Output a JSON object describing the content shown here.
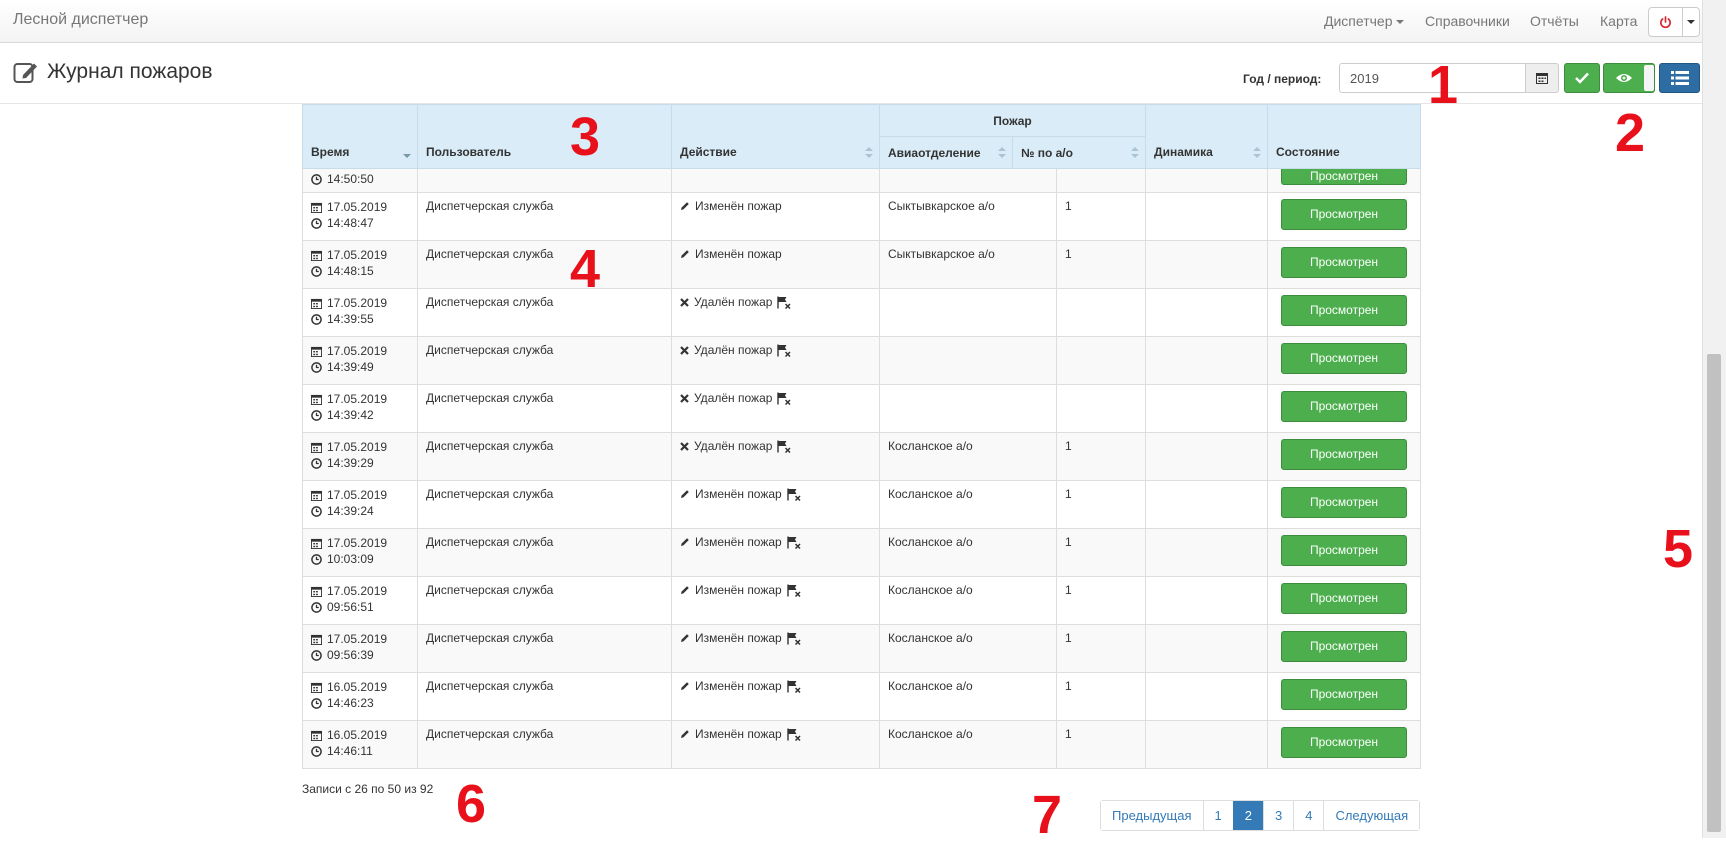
{
  "navbar": {
    "brand": "Лесной диспетчер",
    "items": [
      {
        "label": "Диспетчер",
        "dropdown": true
      },
      {
        "label": "Справочники"
      },
      {
        "label": "Отчёты"
      },
      {
        "label": "Карта"
      }
    ]
  },
  "header": {
    "title": "Журнал пожаров",
    "period_label": "Год / период:",
    "period_value": "2019"
  },
  "table": {
    "columns": {
      "time": "Время",
      "user": "Пользователь",
      "action": "Действие",
      "fire_group": "Пожар",
      "aviadept": "Авиаотделение",
      "num": "№ по а/о",
      "dynamics": "Динамика",
      "state": "Состояние"
    },
    "rows": [
      {
        "date": "",
        "time": "14:50:50",
        "user": "",
        "action": "",
        "action_icon": "",
        "flag": false,
        "aviadept": "",
        "num": "",
        "state": "Просмотрен"
      },
      {
        "date": "17.05.2019",
        "time": "14:48:47",
        "user": "Диспетчерская служба",
        "action": "Изменён пожар",
        "action_icon": "pencil",
        "flag": false,
        "aviadept": "Сыктывкарское а/о",
        "num": "1",
        "state": "Просмотрен"
      },
      {
        "date": "17.05.2019",
        "time": "14:48:15",
        "user": "Диспетчерская служба",
        "action": "Изменён пожар",
        "action_icon": "pencil",
        "flag": false,
        "aviadept": "Сыктывкарское а/о",
        "num": "1",
        "state": "Просмотрен"
      },
      {
        "date": "17.05.2019",
        "time": "14:39:55",
        "user": "Диспетчерская служба",
        "action": "Удалён пожар",
        "action_icon": "cross",
        "flag": true,
        "aviadept": "",
        "num": "",
        "state": "Просмотрен"
      },
      {
        "date": "17.05.2019",
        "time": "14:39:49",
        "user": "Диспетчерская служба",
        "action": "Удалён пожар",
        "action_icon": "cross",
        "flag": true,
        "aviadept": "",
        "num": "",
        "state": "Просмотрен"
      },
      {
        "date": "17.05.2019",
        "time": "14:39:42",
        "user": "Диспетчерская служба",
        "action": "Удалён пожар",
        "action_icon": "cross",
        "flag": true,
        "aviadept": "",
        "num": "",
        "state": "Просмотрен"
      },
      {
        "date": "17.05.2019",
        "time": "14:39:29",
        "user": "Диспетчерская служба",
        "action": "Удалён пожар",
        "action_icon": "cross",
        "flag": true,
        "aviadept": "Косланское а/о",
        "num": "1",
        "state": "Просмотрен"
      },
      {
        "date": "17.05.2019",
        "time": "14:39:24",
        "user": "Диспетчерская служба",
        "action": "Изменён пожар",
        "action_icon": "pencil",
        "flag": true,
        "aviadept": "Косланское а/о",
        "num": "1",
        "state": "Просмотрен"
      },
      {
        "date": "17.05.2019",
        "time": "10:03:09",
        "user": "Диспетчерская служба",
        "action": "Изменён пожар",
        "action_icon": "pencil",
        "flag": true,
        "aviadept": "Косланское а/о",
        "num": "1",
        "state": "Просмотрен"
      },
      {
        "date": "17.05.2019",
        "time": "09:56:51",
        "user": "Диспетчерская служба",
        "action": "Изменён пожар",
        "action_icon": "pencil",
        "flag": true,
        "aviadept": "Косланское а/о",
        "num": "1",
        "state": "Просмотрен"
      },
      {
        "date": "17.05.2019",
        "time": "09:56:39",
        "user": "Диспетчерская служба",
        "action": "Изменён пожар",
        "action_icon": "pencil",
        "flag": true,
        "aviadept": "Косланское а/о",
        "num": "1",
        "state": "Просмотрен"
      },
      {
        "date": "16.05.2019",
        "time": "14:46:23",
        "user": "Диспетчерская служба",
        "action": "Изменён пожар",
        "action_icon": "pencil",
        "flag": true,
        "aviadept": "Косланское а/о",
        "num": "1",
        "state": "Просмотрен"
      },
      {
        "date": "16.05.2019",
        "time": "14:46:11",
        "user": "Диспетчерская служба",
        "action": "Изменён пожар",
        "action_icon": "pencil",
        "flag": true,
        "aviadept": "Косланское а/о",
        "num": "1",
        "state": "Просмотрен"
      }
    ]
  },
  "footer": {
    "info": "Записи с 26 по 50 из 92",
    "pager": [
      "Предыдущая",
      "1",
      "2",
      "3",
      "4",
      "Следующая"
    ],
    "active_page": "2"
  },
  "annotations": [
    "1",
    "2",
    "3",
    "4",
    "5",
    "6",
    "7"
  ],
  "colors": {
    "success": "#4cae4c",
    "primary": "#337ab7",
    "header_bg": "#d9ecf7",
    "annotation": "#e8101a",
    "power": "#d9262e"
  }
}
